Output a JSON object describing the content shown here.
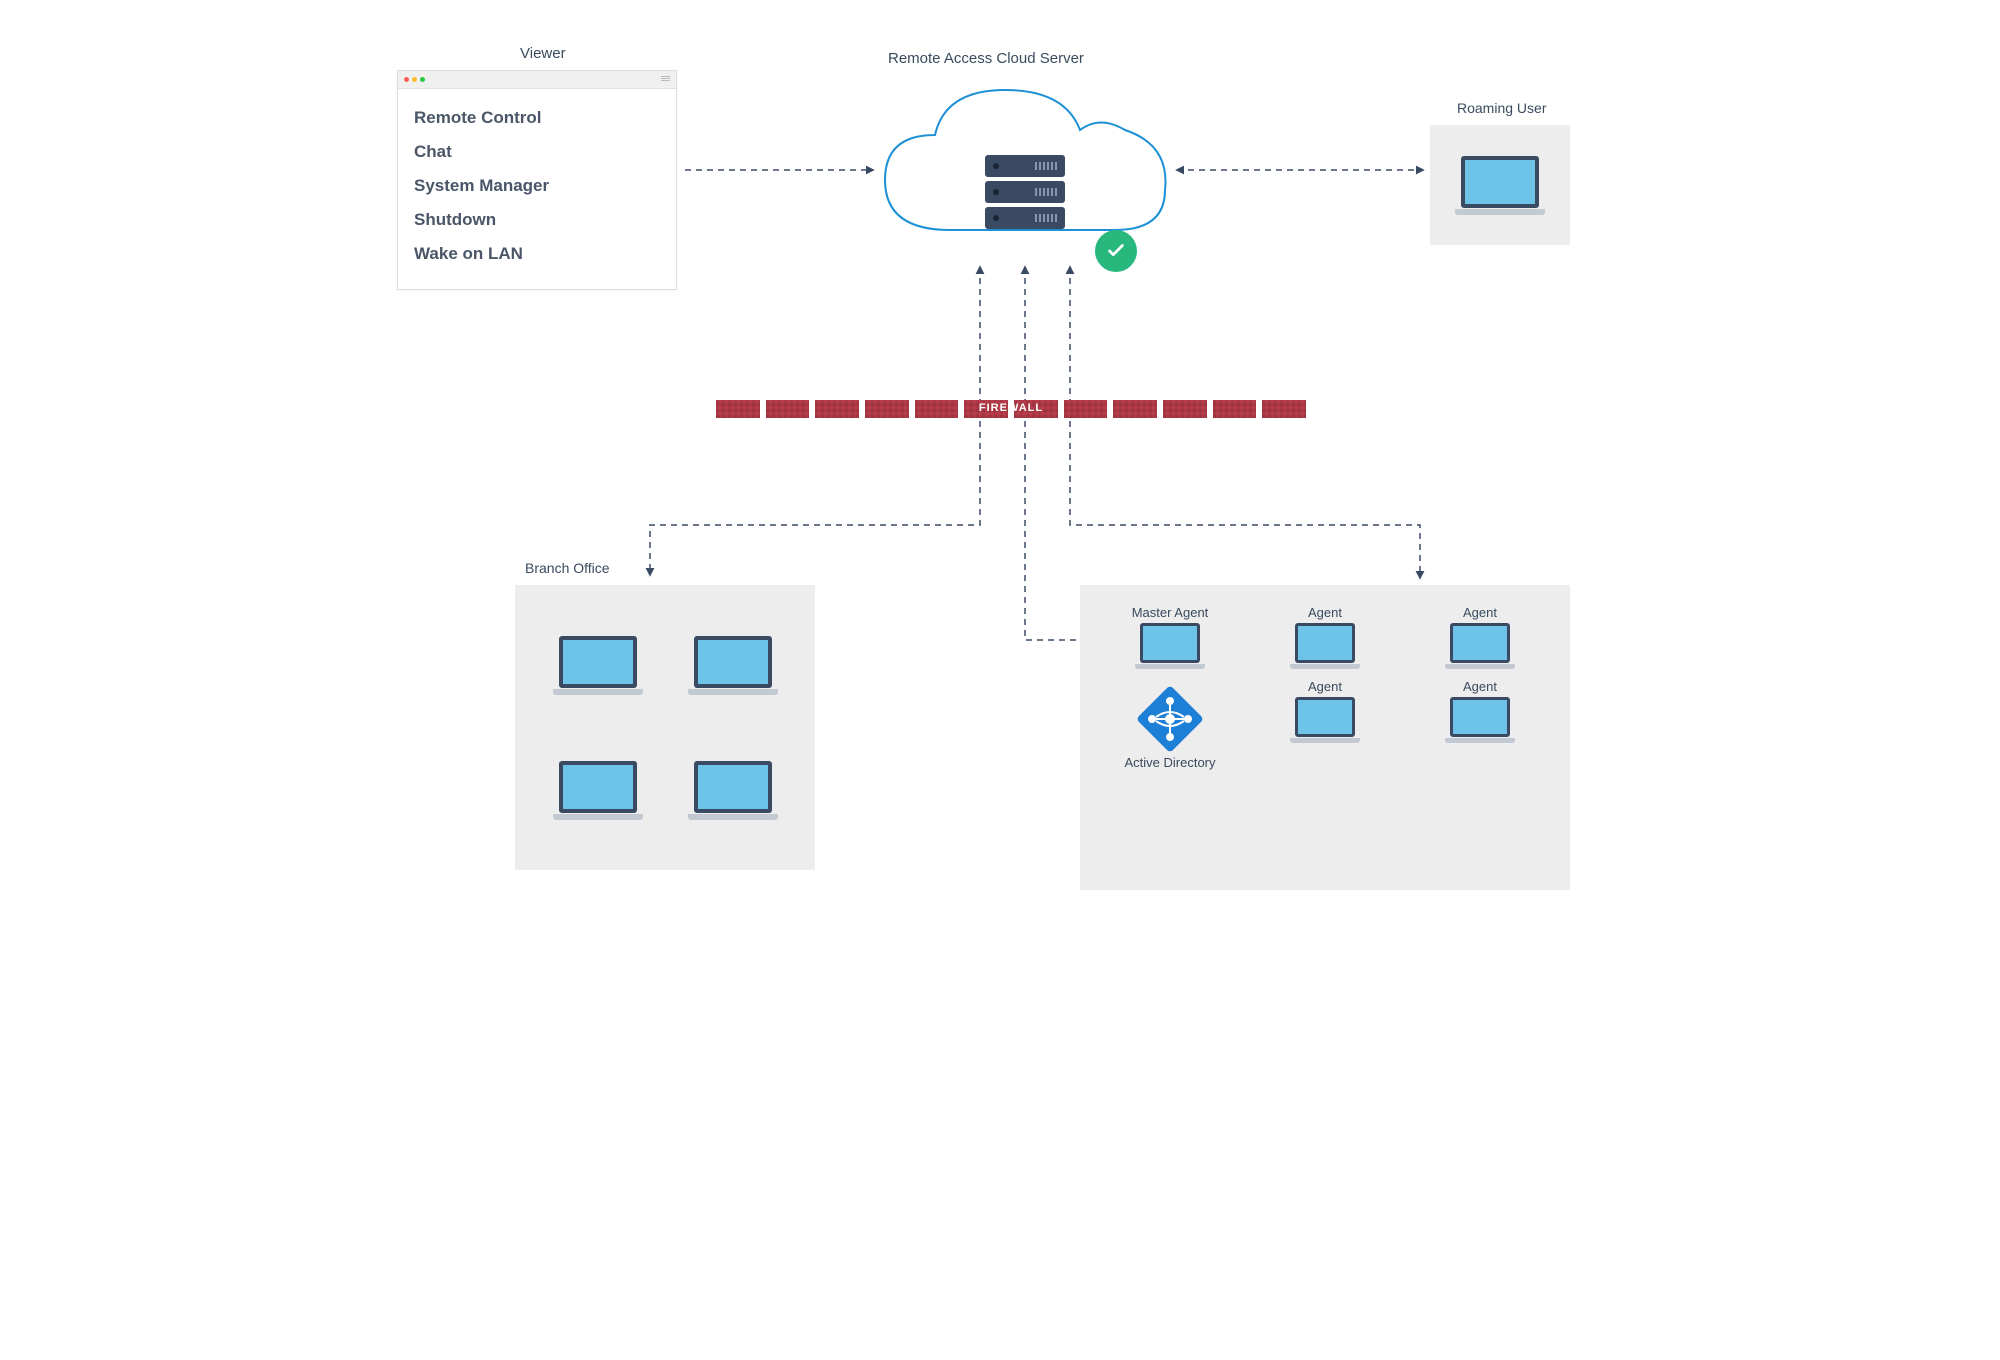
{
  "viewer": {
    "title": "Viewer",
    "items": [
      "Remote Control",
      "Chat",
      "System Manager",
      "Shutdown",
      "Wake on LAN"
    ]
  },
  "cloud": {
    "title": "Remote Access Cloud Server"
  },
  "roaming": {
    "title": "Roaming User"
  },
  "firewall": {
    "label": "FIREWALL"
  },
  "branch": {
    "title": "Branch Office"
  },
  "agents": {
    "master_label": "Master Agent",
    "agent_label": "Agent",
    "ad_label": "Active Directory"
  }
}
